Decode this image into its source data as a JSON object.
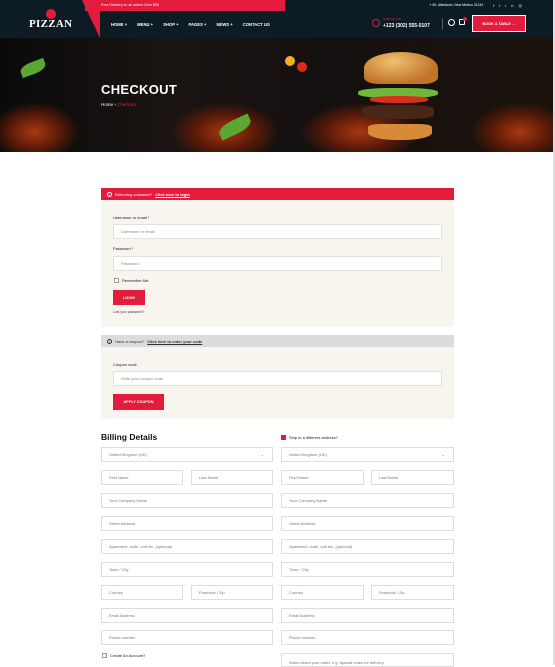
{
  "topbar": {
    "promo": "Free Delivery on all orders Over $50",
    "address": "60, Allentown, New Mexico 31134",
    "social_icons": [
      "facebook-icon",
      "twitter-icon",
      "linkedin-icon",
      "instagram-icon"
    ]
  },
  "brand": {
    "logo_text": "PIZZAN"
  },
  "nav": {
    "items": [
      "HOME +",
      "MENU +",
      "SHOP +",
      "PAGES +",
      "NEWS +",
      "CONTACT US"
    ]
  },
  "header": {
    "phone_label": "Anytime Call",
    "phone_number": "+123 (302) 555-0107",
    "book_label": "BOOK A TABLE →"
  },
  "hero": {
    "title": "CHECKOUT",
    "crumb_home": "Home",
    "crumb_sep": "›",
    "crumb_current": "Checkout"
  },
  "returning": {
    "text": "Returning customer?",
    "link": "Click here to login"
  },
  "login": {
    "username_label": "Username or email *",
    "username_placeholder": "Username or email",
    "password_label": "Password *",
    "password_placeholder": "Password",
    "remember_label": "Remember Me",
    "login_button": "LOGIN",
    "lost_password": "Lost your password?"
  },
  "coupon": {
    "notice_text": "Have a coupon?",
    "notice_link": "Click here to enter your code",
    "label": "Coupon code",
    "placeholder": "Write your coupon code",
    "apply_button": "APPLY COUPON"
  },
  "billing": {
    "title": "Billing Details",
    "country": "United Kingdom (UK)",
    "first_name": "First Name",
    "last_name": "Last Name",
    "company": "Your Company Name",
    "street": "Street Address",
    "apartment": "Apartment, suite, unit etc. (optional)",
    "town": "Town / City",
    "country_field": "Country",
    "postcode": "Postcode / Zip",
    "email": "Email Address",
    "phone": "Phone number",
    "create_account": "Create An Account?"
  },
  "shipping": {
    "ship_label": "Ship to a different address?",
    "country": "United Kingdom (UK)",
    "first_name": "First Name",
    "last_name": "Last Name",
    "company": "Your Company Name",
    "street": "Street Address",
    "apartment": "Apartment, suite, unit etc. (optional)",
    "town": "Town / City",
    "country_field": "Country",
    "postcode": "Postcode / Zip",
    "email": "Email Address",
    "phone": "Phone number",
    "notes": "Notes about your order, e.g. special notes for delivery."
  },
  "colors": {
    "accent": "#e31b3c",
    "dark": "#0d1b24",
    "panel": "#f8f4ee"
  }
}
